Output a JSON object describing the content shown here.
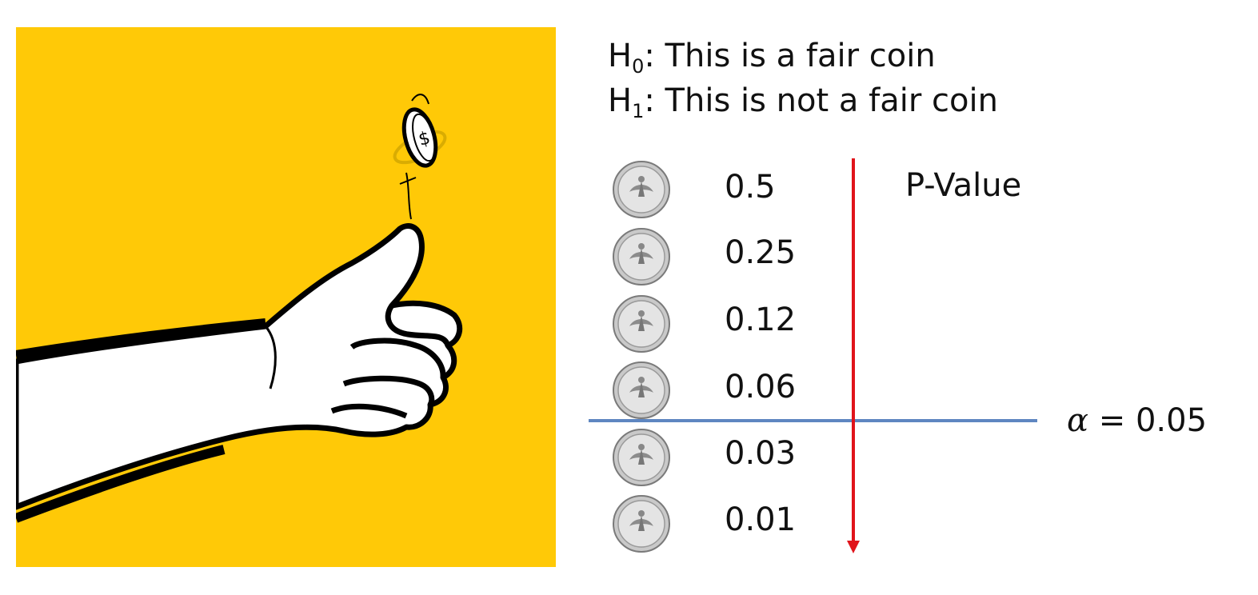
{
  "hypotheses": {
    "h0": {
      "letter": "H",
      "sub": "0",
      "text": ": This is a fair coin"
    },
    "h1": {
      "letter": "H",
      "sub": "1",
      "text": ": This is not a fair coin"
    }
  },
  "pvalue_label": "P-Value",
  "pvalues": [
    "0.5",
    "0.25",
    "0.12",
    "0.06",
    "0.03",
    "0.01"
  ],
  "alpha": {
    "symbol": "α",
    "text": " = 0.05"
  },
  "colors": {
    "background_panel": "#FFC907",
    "arrow": "#E0141B",
    "threshold_line": "#5E86C1",
    "coin": "#C9C9C9"
  },
  "icons": {
    "illustration": "thumb-flipping-coin-illustration",
    "coin": "quarter-coin-icon"
  }
}
